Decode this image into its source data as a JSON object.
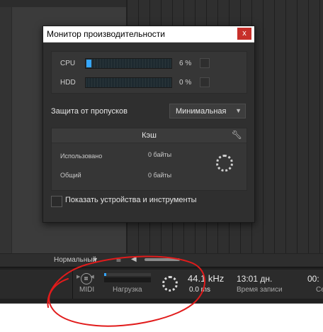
{
  "dialog": {
    "title": "Монитор производительности",
    "close_label": "x",
    "meters": [
      {
        "label": "CPU",
        "value_text": "6 %",
        "level": 0.06
      },
      {
        "label": "HDD",
        "value_text": "0 %",
        "level": 0
      }
    ],
    "protection": {
      "label": "Защита от пропусков",
      "value": "Минимальная"
    },
    "cache": {
      "title": "Кэш",
      "rows": [
        {
          "label": "Использовано",
          "value": "0 байты"
        },
        {
          "label": "Общий",
          "value": "0 байты"
        }
      ]
    },
    "show_devices_label": "Показать устройства и инструменты"
  },
  "control_bar": {
    "mode": "Нормальный"
  },
  "transport": {
    "midi_label": "MIDI",
    "load_label": "Нагрузка",
    "load_level": 0.04,
    "sample_rate": "44.1 kHz",
    "latency": "0.0 ms",
    "record_time": "13:01 дн.",
    "record_label": "Время записи",
    "sec_time": "00:",
    "sec_label": "Се"
  },
  "colors": {
    "accent": "#35a6ff",
    "close": "#c7302b",
    "annotation": "#e11b1b"
  }
}
